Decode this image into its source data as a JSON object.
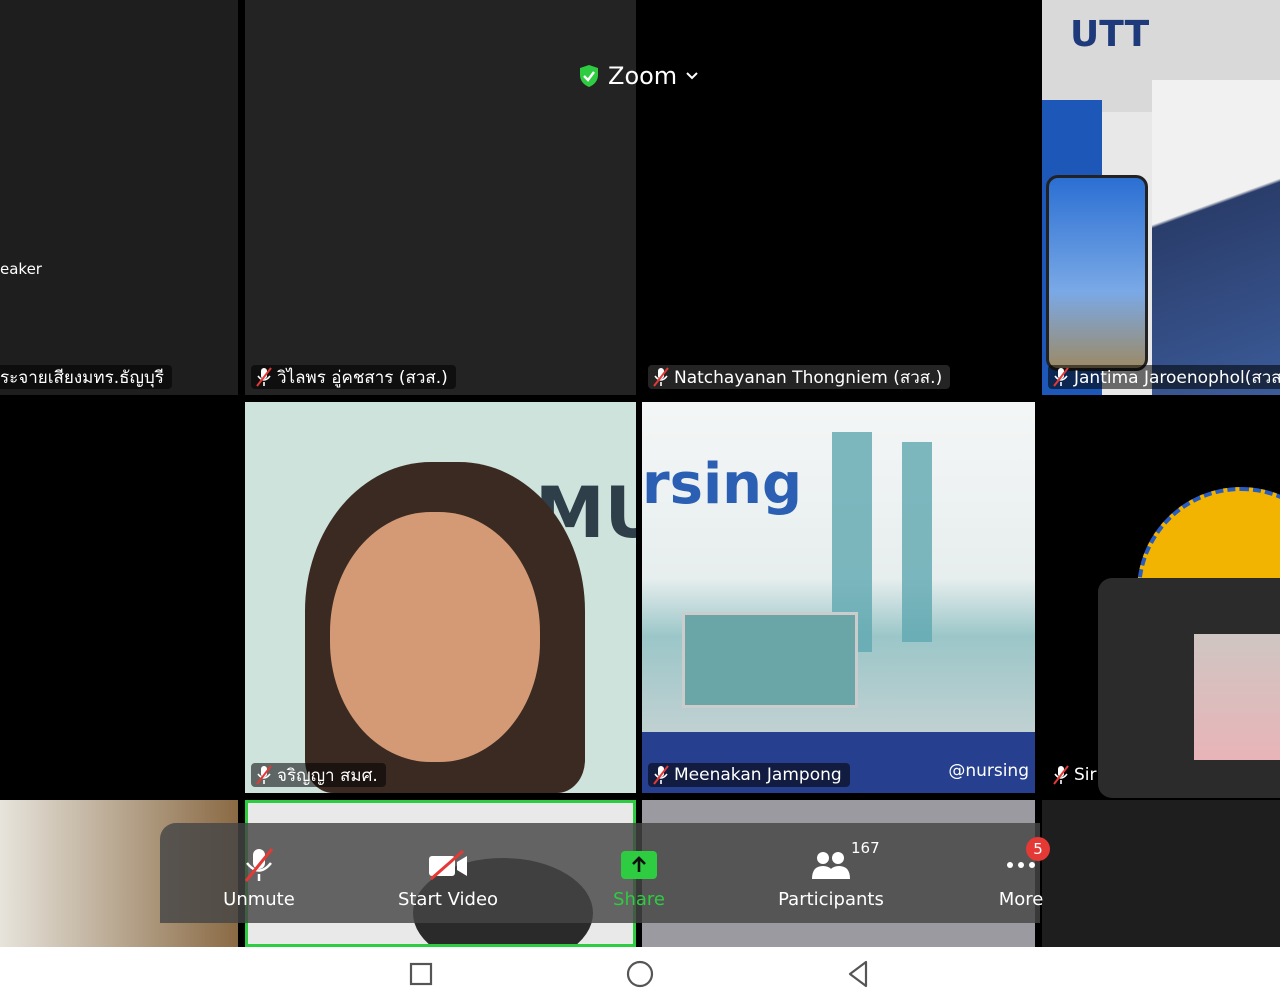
{
  "header": {
    "app_title": "Zoom",
    "secure_icon": "shield-check-icon",
    "dropdown_icon": "chevron-down-icon"
  },
  "tiles": {
    "r1c1": {
      "name": "ระจายเสียงมทร.ธัญบุรี",
      "extra": "eaker"
    },
    "r1c2": {
      "name": "วิไลพร  อู่คชสาร (สวส.)"
    },
    "r1c3": {
      "name": "Natchayanan Thongniem (สวส.)"
    },
    "r1c4": {
      "name": "Jantima Jaroenophol(สวส",
      "logo_text": "UTT"
    },
    "r2c2": {
      "name": "จริญญา สมศ.",
      "bg_text": "MU"
    },
    "r2c3": {
      "name": "Meenakan Jampong",
      "bg_text": "rsing",
      "watermark": "@nursing"
    },
    "r2c4": {
      "name": "Sir"
    }
  },
  "toolbar": {
    "unmute": "Unmute",
    "start_video": "Start Video",
    "share": "Share",
    "participants": "Participants",
    "participants_count": "167",
    "more": "More",
    "more_badge": "5"
  },
  "colors": {
    "accent_green": "#2ecc40",
    "badge_red": "#e53935",
    "toolbar_bg": "#464646"
  }
}
